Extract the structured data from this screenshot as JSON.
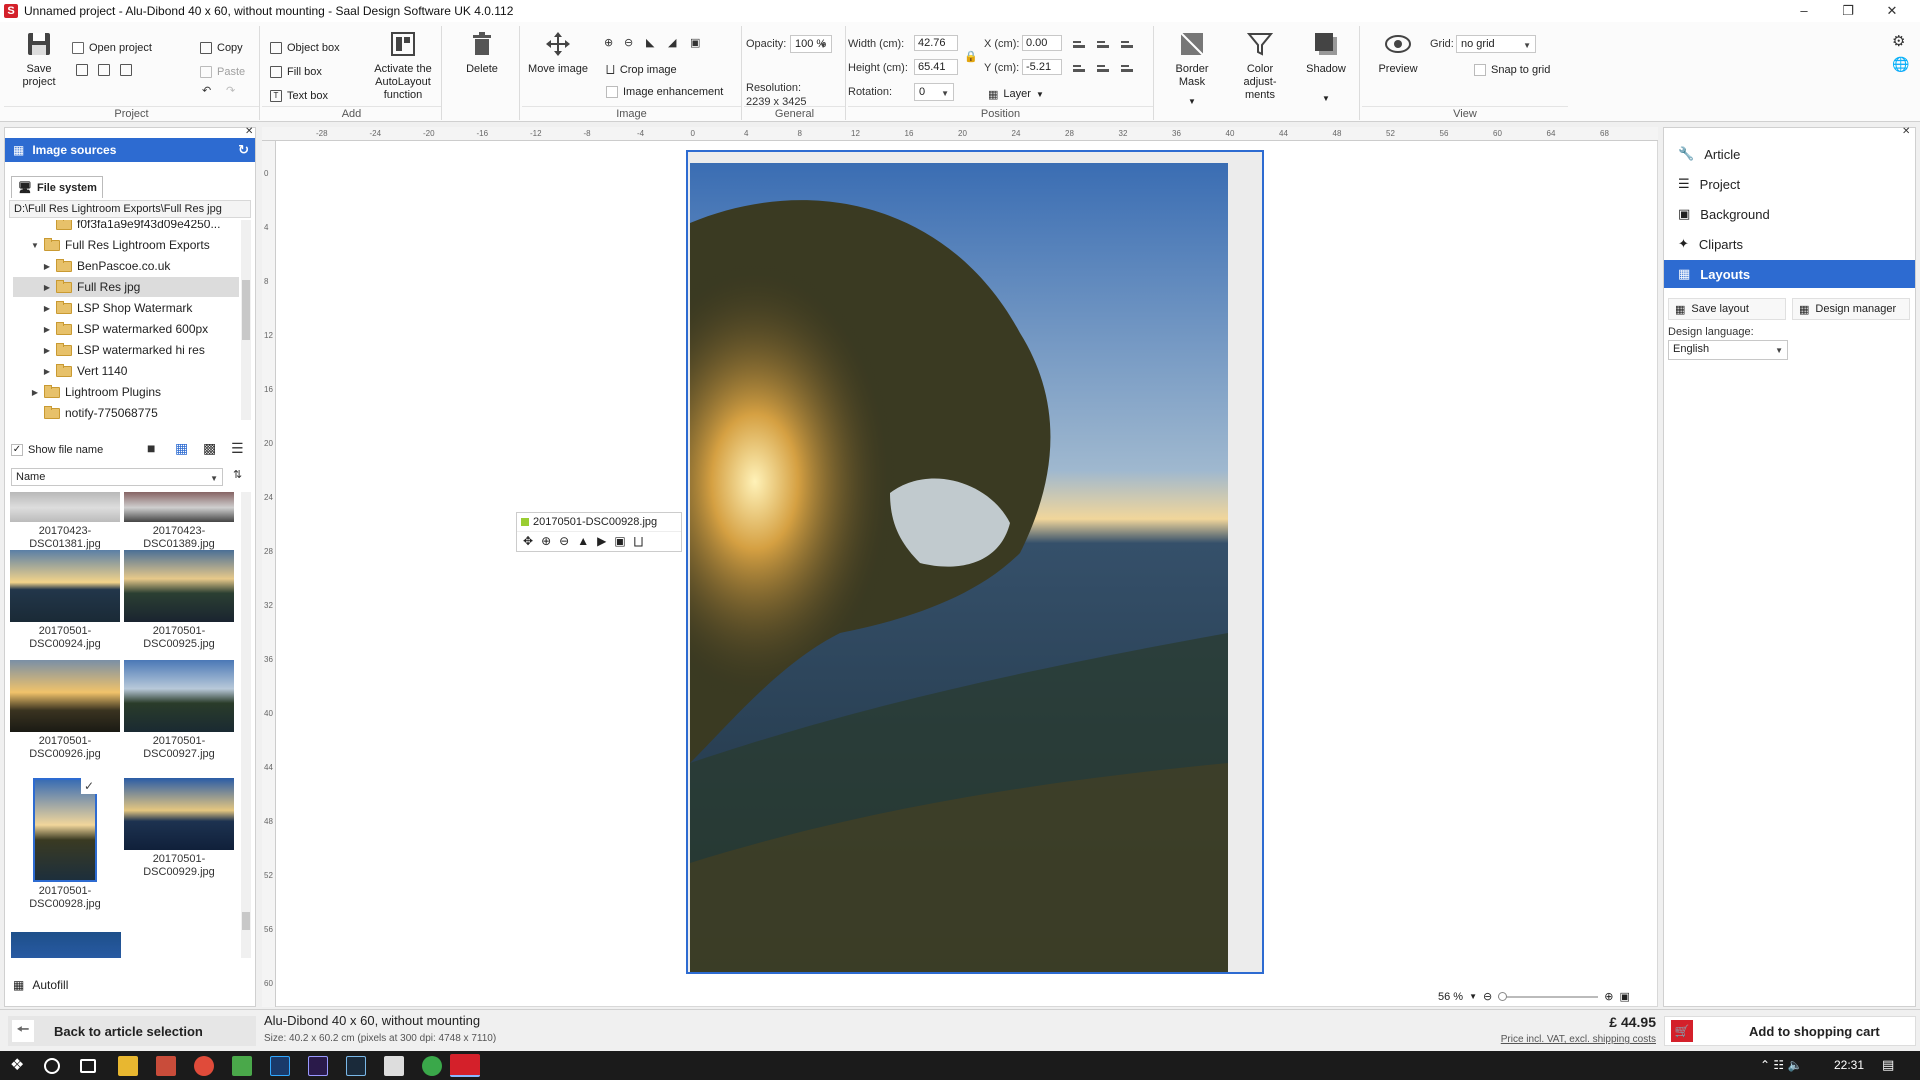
{
  "window": {
    "title": "Unnamed project - Alu-Dibond 40 x 60, without mounting - Saal Design Software UK 4.0.112",
    "app_icon_letter": "S"
  },
  "ribbon": {
    "project": {
      "label": "Project",
      "save_project": "Save project",
      "open_project": "Open project",
      "copy": "Copy",
      "paste": "Paste"
    },
    "add": {
      "label": "Add",
      "object_box": "Object box",
      "fill_box": "Fill box",
      "text_box": "Text box",
      "autolayout": "Activate the AutoLayout function"
    },
    "delete": "Delete",
    "image": {
      "label": "Image",
      "move_image": "Move image",
      "crop_image": "Crop image",
      "image_enhancement": "Image enhancement"
    },
    "general": {
      "label": "General",
      "opacity_label": "Opacity:",
      "opacity_value": "100 %",
      "resolution_label": "Resolution:",
      "resolution_value": "2239 x 3425"
    },
    "position": {
      "label": "Position",
      "width_label": "Width (cm):",
      "width_value": "42.76",
      "height_label": "Height (cm):",
      "height_value": "65.41",
      "rotation_label": "Rotation:",
      "rotation_value": "0",
      "x_label": "X (cm):",
      "x_value": "0.00",
      "y_label": "Y (cm):",
      "y_value": "-5.21",
      "layer": "Layer"
    },
    "border_mask": "Border Mask",
    "color_adjustments": "Color adjust-ments",
    "shadow": "Shadow",
    "preview": "Preview",
    "view": {
      "label": "View",
      "grid_label": "Grid:",
      "grid_value": "no grid",
      "snap_to_grid": "Snap to grid"
    }
  },
  "left_panel": {
    "header": "Image sources",
    "tab": "File system",
    "path": "D:\\Full Res Lightroom Exports\\Full Res jpg",
    "tree": [
      {
        "label": "f0f3fa1a9e9f43d09e4250...",
        "level": 2,
        "caret": ""
      },
      {
        "label": "Full Res Lightroom Exports",
        "level": 1,
        "caret": "▼"
      },
      {
        "label": "BenPascoe.co.uk",
        "level": 2,
        "caret": "▶"
      },
      {
        "label": "Full Res jpg",
        "level": 2,
        "caret": "▶"
      },
      {
        "label": "LSP Shop Watermark",
        "level": 2,
        "caret": "▶"
      },
      {
        "label": "LSP watermarked 600px",
        "level": 2,
        "caret": "▶"
      },
      {
        "label": "LSP watermarked hi res",
        "level": 2,
        "caret": "▶"
      },
      {
        "label": "Vert 1140",
        "level": 2,
        "caret": "▶"
      },
      {
        "label": "Lightroom Plugins",
        "level": 1,
        "caret": "▶"
      },
      {
        "label": "notify-775068775",
        "level": 1,
        "caret": ""
      }
    ],
    "show_file_name": "Show file name",
    "sort_label": "Name",
    "thumbnails": [
      {
        "line1": "20170423-",
        "line2": "DSC01381.jpg"
      },
      {
        "line1": "20170423-",
        "line2": "DSC01389.jpg"
      },
      {
        "line1": "20170501-",
        "line2": "DSC00924.jpg"
      },
      {
        "line1": "20170501-",
        "line2": "DSC00925.jpg"
      },
      {
        "line1": "20170501-",
        "line2": "DSC00926.jpg"
      },
      {
        "line1": "20170501-",
        "line2": "DSC00927.jpg"
      },
      {
        "line1": "20170501-",
        "line2": "DSC00928.jpg"
      },
      {
        "line1": "20170501-",
        "line2": "DSC00929.jpg"
      }
    ],
    "autofill": "Autofill"
  },
  "canvas": {
    "image_tag": "20170501-DSC00928.jpg",
    "ruler_h": [
      "-28",
      "-24",
      "-20",
      "-16",
      "-12",
      "-8",
      "-4",
      "0",
      "4",
      "8",
      "12",
      "16",
      "20",
      "24",
      "28",
      "32",
      "36",
      "40",
      "44",
      "48",
      "52",
      "56",
      "60",
      "64",
      "68"
    ],
    "ruler_v": [
      "0",
      "4",
      "8",
      "12",
      "16",
      "20",
      "24",
      "28",
      "32",
      "36",
      "40",
      "44",
      "48",
      "52",
      "56",
      "60"
    ],
    "zoom": "56 %"
  },
  "right_panel": {
    "items": [
      "Article",
      "Project",
      "Background",
      "Cliparts",
      "Layouts"
    ],
    "active": "Layouts",
    "save_layout": "Save layout",
    "design_manager": "Design manager",
    "design_language_label": "Design language:",
    "design_language_value": "English"
  },
  "status": {
    "back": "Back to article selection",
    "product": "Alu-Dibond 40 x 60, without mounting",
    "size": "Size: 40.2 x 60.2 cm (pixels at 300 dpi: 4748 x 7110)",
    "price": "£ 44.95",
    "price_note": "Price incl. VAT, excl. shipping costs",
    "add_to_cart": "Add to shopping cart"
  },
  "taskbar": {
    "time": "22:31"
  },
  "colors": {
    "accent": "#2d6bd1",
    "brand_red": "#d4202a"
  }
}
